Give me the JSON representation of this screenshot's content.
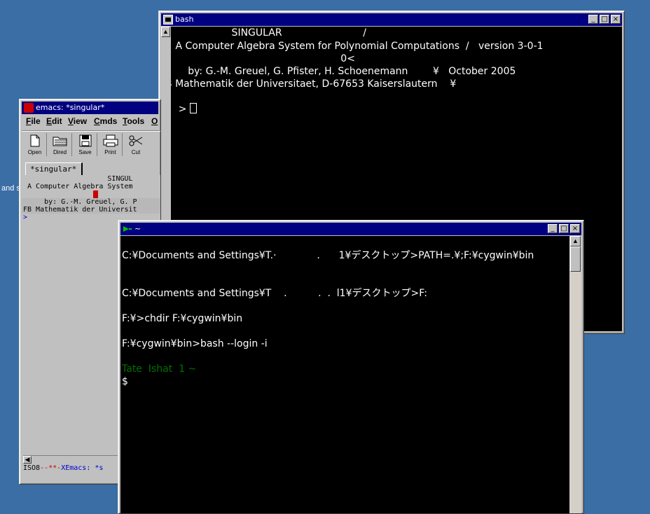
{
  "desktop": {
    "partial_text": "and s"
  },
  "bash_window": {
    "title": "bash",
    "controls": {
      "minimize": "_",
      "maximize": "□",
      "close": "×"
    },
    "lines": [
      "                   SINGULAR                          /",
      " A Computer Algebra System for Polynomial Computations  /   version 3-0-1",
      "                                                      0<",
      "     by: G.-M. Greuel, G. Pfister, H. Schoenemann        ¥   October 2005",
      "FB Mathematik der Universitaet, D-67653 Kaiserslautern    ¥"
    ],
    "prompt": "> "
  },
  "emacs_window": {
    "title": "emacs: *singular*",
    "menu": [
      "File",
      "Edit",
      "View",
      "Cmds",
      "Tools",
      "O"
    ],
    "toolbar": [
      "Open",
      "Dired",
      "Save",
      "Print",
      "Cut"
    ],
    "tab": "*singular*",
    "buffer_lines": [
      "                    SINGUL",
      " A Computer Algebra System",
      "",
      "     by: G.-M. Greuel, G. P",
      "FB Mathematik der Universit",
      ">"
    ],
    "modeline_prefix": "ISO8",
    "modeline_dashes": "--**-",
    "modeline_name": "XEmacs: *s"
  },
  "cygwin_window": {
    "title": "~",
    "controls": {
      "minimize": "_",
      "maximize": "□",
      "close": "×"
    },
    "lines": [
      "C:¥Documents and Settings¥T.·             .      1¥デスクトップ>PATH=.¥;F:¥cygwin¥bin",
      "",
      "C:¥Documents and Settings¥T    .          .  .  l1¥デスクトップ>F:",
      "F:¥>chdir F:¥cygwin¥bin",
      "F:¥cygwin¥bin>bash --login -i"
    ],
    "green_line": "Tate  Ishat  1 ~",
    "prompt": "$"
  },
  "colors": {
    "desktop": "#3a6ea5",
    "titlebar": "#000080",
    "terminal_bg": "#000000",
    "terminal_fg": "#ffffff",
    "cygwin_green": "#00a000",
    "emacs_cursor": "#cc0000"
  }
}
